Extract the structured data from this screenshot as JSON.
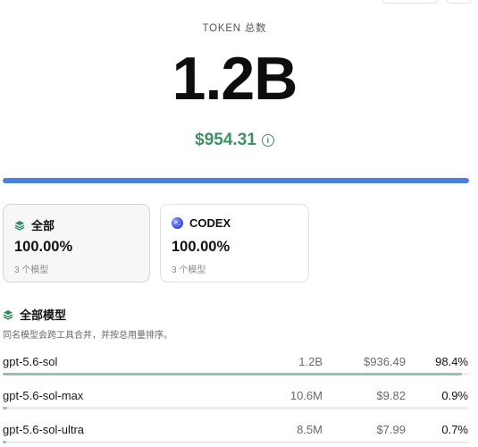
{
  "hero": {
    "label": "TOKEN 总数",
    "value": "1.2B",
    "cost": "$954.31",
    "info_icon": "info-icon",
    "total_bar_fraction": 1.0
  },
  "filters": [
    {
      "icon": "layers-icon",
      "title": "全部",
      "percent": "100.00%",
      "sub": "3 个模型",
      "active": true
    },
    {
      "icon": "codex-icon",
      "title": "CODEX",
      "percent": "100.00%",
      "sub": "3 个模型",
      "active": false
    }
  ],
  "models_section": {
    "icon": "layers-icon",
    "title": "全部模型",
    "description": "同名模型会跨工具合并，并按总用量排序。"
  },
  "models": [
    {
      "name": "gpt-5.6-sol",
      "tokens": "1.2B",
      "cost": "$936.49",
      "share": "98.4%",
      "share_fraction": 0.984
    },
    {
      "name": "gpt-5.6-sol-max",
      "tokens": "10.6M",
      "cost": "$9.82",
      "share": "0.9%",
      "share_fraction": 0.009
    },
    {
      "name": "gpt-5.6-sol-ultra",
      "tokens": "8.5M",
      "cost": "$7.99",
      "share": "0.7%",
      "share_fraction": 0.007
    }
  ],
  "colors": {
    "accent_blue": "#4a7fe0",
    "cost_green": "#3f8f64",
    "share_bar": "#93c5ae"
  }
}
